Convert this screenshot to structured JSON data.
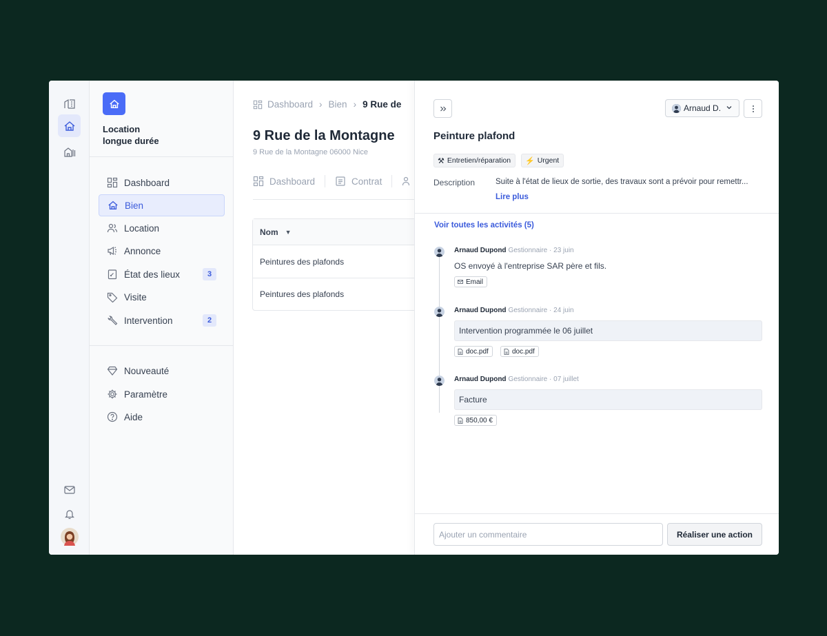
{
  "rail": {
    "items": [
      {
        "name": "buildings-icon"
      },
      {
        "name": "home-icon"
      },
      {
        "name": "apartments-icon"
      }
    ],
    "bottom": [
      {
        "name": "mail-icon"
      },
      {
        "name": "bell-icon"
      }
    ]
  },
  "sidebar": {
    "brand_title": "Location\nlongue durée",
    "items": [
      {
        "label": "Dashboard",
        "icon": "dashboard-icon"
      },
      {
        "label": "Bien",
        "icon": "home-icon"
      },
      {
        "label": "Location",
        "icon": "users-icon"
      },
      {
        "label": "Annonce",
        "icon": "megaphone-icon"
      },
      {
        "label": "État des lieux",
        "icon": "clipboard-icon",
        "badge": "3"
      },
      {
        "label": "Visite",
        "icon": "tag-icon"
      },
      {
        "label": "Intervention",
        "icon": "wrench-icon",
        "badge": "2"
      }
    ],
    "bottom_items": [
      {
        "label": "Nouveauté",
        "icon": "diamond-icon"
      },
      {
        "label": "Paramètre",
        "icon": "gear-icon"
      },
      {
        "label": "Aide",
        "icon": "help-icon"
      }
    ]
  },
  "main": {
    "breadcrumb": [
      "Dashboard",
      "Bien",
      "9 Rue de"
    ],
    "title": "9 Rue de la Montagne",
    "subtitle": "9 Rue de la Montagne 06000 Nice",
    "tabs": [
      "Dashboard",
      "Contrat"
    ],
    "table": {
      "header": "Nom",
      "rows": [
        "Peintures des plafonds",
        "Peintures des plafonds"
      ]
    }
  },
  "panel": {
    "assignee": "Arnaud D.",
    "title": "Peinture plafond",
    "tags": [
      {
        "icon": "tools-icon",
        "label": "Entretien/réparation"
      },
      {
        "icon": "bolt-icon",
        "label": "Urgent"
      }
    ],
    "description_label": "Description",
    "description": "Suite à l'état de lieux de sortie, des travaux sont a prévoir pour remettr...",
    "read_more": "Lire plus",
    "see_all": "Voir toutes les activités (5)",
    "activities": [
      {
        "author": "Arnaud Dupond",
        "meta": "Gestionnaire · 23 juin",
        "text": "OS envoyé à l'entreprise SAR père et fils.",
        "attachments": [
          "Email"
        ]
      },
      {
        "author": "Arnaud Dupond",
        "meta": "Gestionnaire · 24 juin",
        "text": "Intervention programmée le 06 juillet",
        "attachments": [
          "doc.pdf",
          "doc.pdf"
        ]
      },
      {
        "author": "Arnaud Dupond",
        "meta": "Gestionnaire · 07 juillet",
        "text": "Facture",
        "attachments": [
          "850,00 €"
        ]
      }
    ],
    "comment_placeholder": "Ajouter un commentaire",
    "action_label": "Réaliser une action"
  },
  "colors": {
    "accent": "#4a6cf7",
    "link": "#3b5bdb",
    "background": "#0c2820"
  }
}
